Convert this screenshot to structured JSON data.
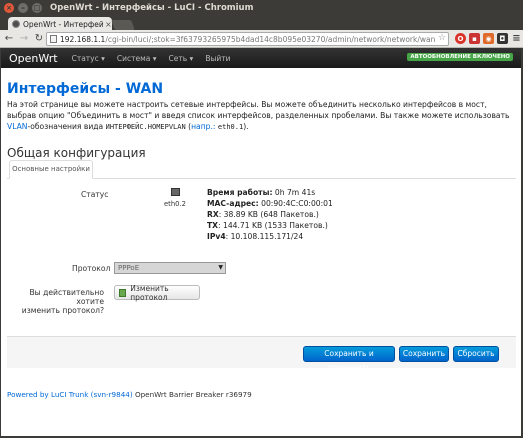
{
  "window": {
    "title": "OpenWrt - Интерфейсы - LuCI - Chromium"
  },
  "tab": {
    "label": "OpenWrt - Интерфейсы -",
    "close": "×"
  },
  "address": {
    "host": "192.168.1.1",
    "path": "/cgi-bin/luci/;stok=3f63793265975b4dad14c8b095e03270/admin/network/network/wan"
  },
  "navbar": {
    "brand": "OpenWrt",
    "menu": [
      "Статус ▾",
      "Система ▾",
      "Сеть ▾",
      "Выйти"
    ],
    "autorefresh": "АВТООБНОВЛЕНИЕ ВКЛЮЧЕНО"
  },
  "page": {
    "title": "Интерфейсы - WAN",
    "desc_1": "На этой странице вы можете настроить сетевые интерфейсы. Вы можете объединить несколько интерфейсов в мост, выбрав опцию \"Объединить в мост\" и введя список интерфейсов, разделенных пробелами. Вы также можете использовать ",
    "desc_vlan": "VLAN",
    "desc_2": "-обозначения вида ",
    "desc_mono": "ИНТЕРФЕЙС.НОМЕРVLAN",
    "desc_3": " (",
    "desc_example": "напр.:",
    "desc_4": " ",
    "desc_example_mono": "eth0.1",
    "desc_5": ").",
    "section_title": "Общая конфигурация",
    "tab_basic": "Основные настройки"
  },
  "status": {
    "label": "Статус",
    "iface": "eth0.2",
    "uptime_label": "Время работы:",
    "uptime": " 0h 7m 41s",
    "mac_label": "MAC-адрес:",
    "mac": " 00:90:4C:C0:00:01",
    "rx_label": "RX",
    "rx": ": 38.89 KB (648 Пакетов.)",
    "tx_label": "TX",
    "tx": ": 144.71 KB (1533 Пакетов.)",
    "ipv4_label": "IPv4",
    "ipv4": ": 10.108.115.171/24"
  },
  "protocol": {
    "label": "Протокол",
    "value": "PPPoE",
    "switch_label_1": "Вы действительно хотите",
    "switch_label_2": "изменить протокол?",
    "switch_button": "Изменить протокол"
  },
  "actions": {
    "save_apply": "Сохранить и применить",
    "save": "Сохранить",
    "reset": "Сбросить"
  },
  "footer": {
    "link": "Powered by LuCI Trunk (svn-r9844)",
    "text": " OpenWrt Barrier Breaker r36979"
  }
}
